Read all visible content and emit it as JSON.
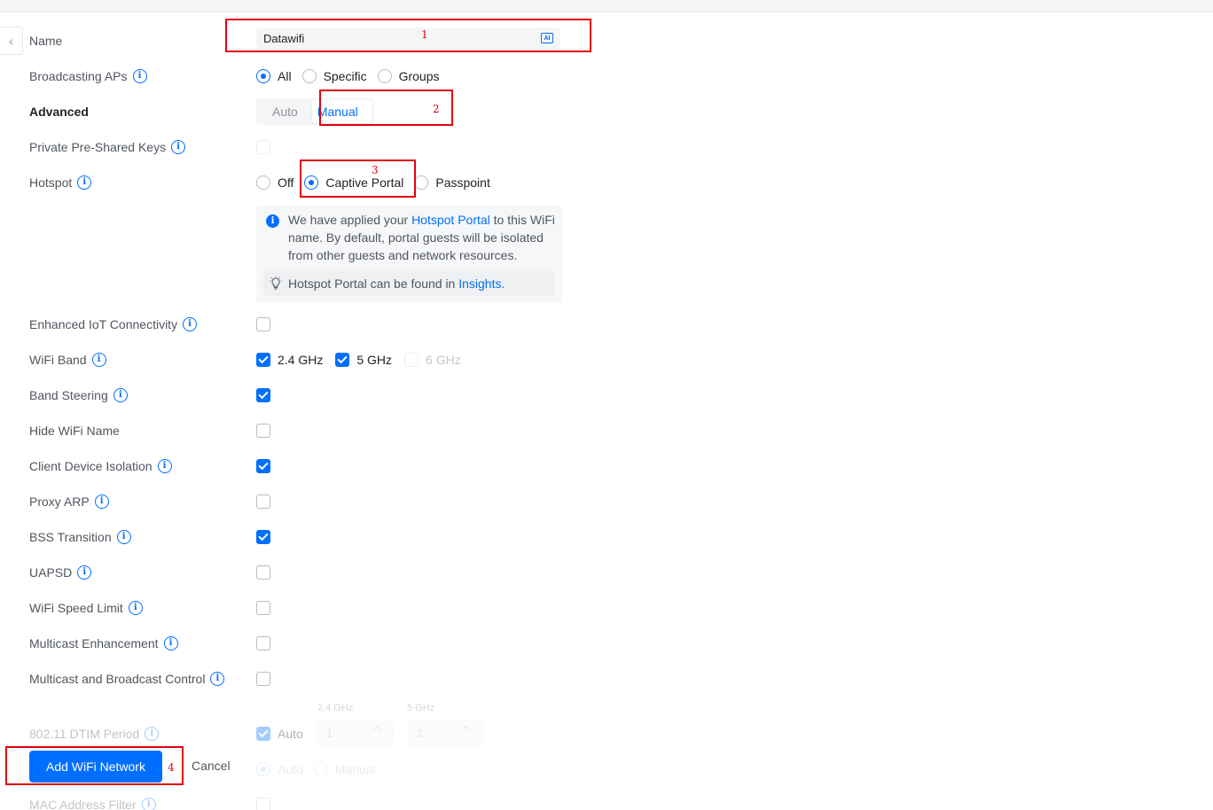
{
  "form": {
    "name": {
      "label": "Name",
      "value": "Datawifi",
      "ai_icon": "AI"
    },
    "broadcasting_aps": {
      "label": "Broadcasting APs",
      "options": [
        "All",
        "Specific",
        "Groups"
      ],
      "selected": "All"
    },
    "advanced": {
      "label": "Advanced",
      "tabs": [
        "Auto",
        "Manual"
      ],
      "selected": "Manual"
    },
    "private_psk": {
      "label": "Private Pre-Shared Keys",
      "checked": false
    },
    "hotspot": {
      "label": "Hotspot",
      "options": [
        "Off",
        "Captive Portal",
        "Passpoint"
      ],
      "selected": "Captive Portal"
    },
    "notice": {
      "text_1": "We have applied your ",
      "link_1": "Hotspot Portal",
      "text_2": " to this WiFi name. By default, portal guests will be isolated from other guests and network resources.",
      "tip_text": "Hotspot Portal can be found in ",
      "tip_link": "Insights",
      "tip_end": "."
    },
    "enhanced_iot": {
      "label": "Enhanced IoT Connectivity",
      "checked": false
    },
    "wifi_band": {
      "label": "WiFi Band",
      "bands": [
        {
          "label": "2.4 GHz",
          "checked": true
        },
        {
          "label": "5 GHz",
          "checked": true
        },
        {
          "label": "6 GHz",
          "checked": false,
          "disabled": true
        }
      ]
    },
    "band_steering": {
      "label": "Band Steering",
      "checked": true
    },
    "hide_wifi_name": {
      "label": "Hide WiFi Name",
      "checked": false
    },
    "client_isolation": {
      "label": "Client Device Isolation",
      "checked": true
    },
    "proxy_arp": {
      "label": "Proxy ARP",
      "checked": false
    },
    "bss_transition": {
      "label": "BSS Transition",
      "checked": true
    },
    "uapsd": {
      "label": "UAPSD",
      "checked": false
    },
    "speed_limit": {
      "label": "WiFi Speed Limit",
      "checked": false
    },
    "multicast_enh": {
      "label": "Multicast Enhancement",
      "checked": false
    },
    "multicast_bc": {
      "label": "Multicast and Broadcast Control",
      "checked": false
    },
    "dtim": {
      "label": "802.11 DTIM Period",
      "auto_label": "Auto",
      "col_24": "2.4 GHz",
      "col_5": "5 GHz",
      "val_24": "1",
      "val_5": "3"
    },
    "row_mode": {
      "options": [
        "Auto",
        "Manual"
      ]
    },
    "mac_filter": {
      "label": "MAC Address Filter"
    }
  },
  "footer": {
    "submit": "Add WiFi Network",
    "cancel": "Cancel"
  },
  "annotations": {
    "n1": "1",
    "n2": "2",
    "n3": "3",
    "n4": "4",
    "color": "#e4000f"
  },
  "colors": {
    "accent": "#006fff"
  }
}
